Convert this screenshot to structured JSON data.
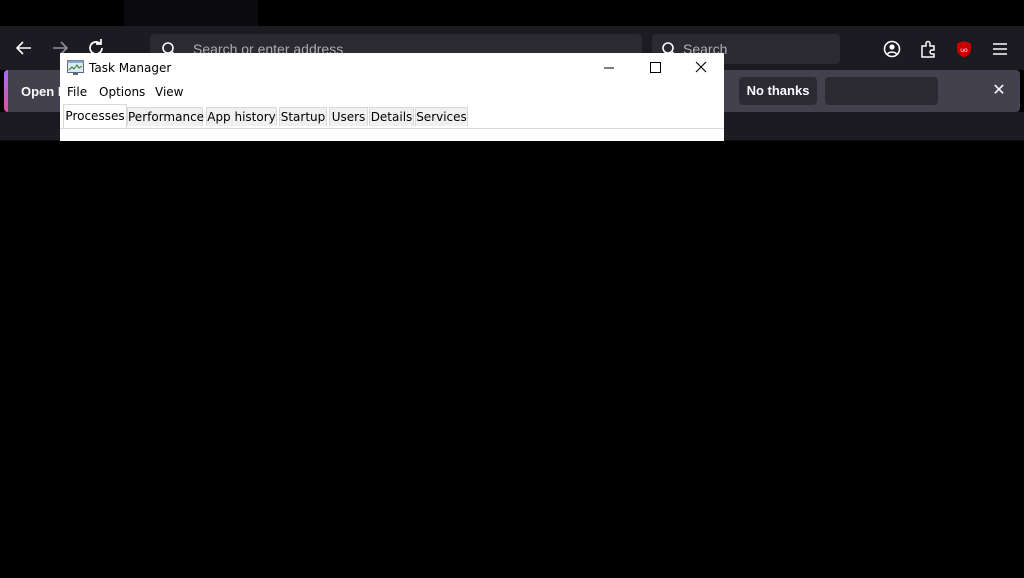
{
  "browser": {
    "url_placeholder": "Search or enter address",
    "search_placeholder": "Search",
    "notification": {
      "text": "Open F",
      "no_thanks_label": "No thanks",
      "close_symbol": "✕"
    },
    "colors": {
      "toolbar": "#1c1b22",
      "urlbar": "#2b2a33",
      "notification": "#42414d",
      "ublock": "#c80000"
    },
    "icons": [
      "back-arrow-icon",
      "forward-arrow-icon",
      "reload-icon",
      "search-icon",
      "account-icon",
      "extensions-icon",
      "ublock-icon",
      "menu-icon"
    ]
  },
  "task_manager": {
    "title": "Task Manager",
    "menu": [
      "File",
      "Options",
      "View"
    ],
    "tabs": [
      "Processes",
      "Performance",
      "App history",
      "Startup",
      "Users",
      "Details",
      "Services"
    ],
    "active_tab": "Processes"
  }
}
